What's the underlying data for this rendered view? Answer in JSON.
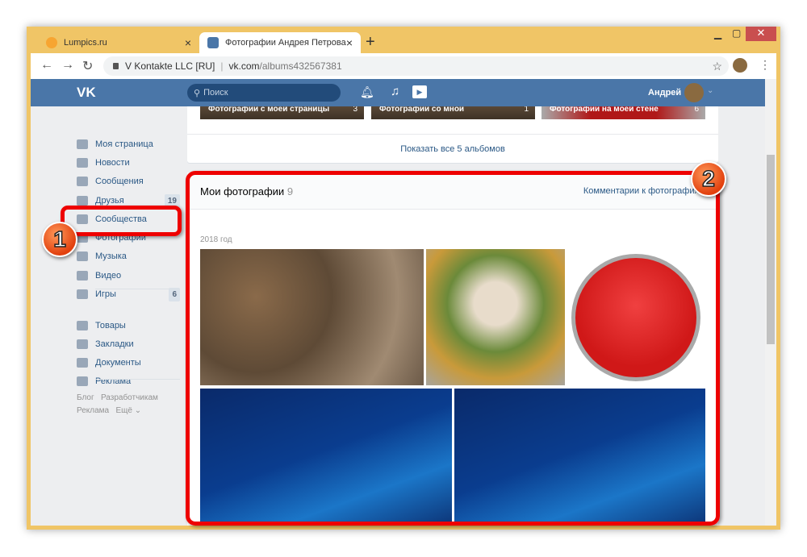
{
  "browser": {
    "tabs": [
      {
        "title": "Lumpics.ru"
      },
      {
        "title": "Фотографии Андрея Петрова –"
      }
    ],
    "site_identity": "V Kontakte LLC [RU]",
    "url_host": "vk.com",
    "url_path": "/albums432567381"
  },
  "vk": {
    "search_placeholder": "Поиск",
    "user_name": "Андрей"
  },
  "sidebar": {
    "items": [
      {
        "label": "Моя страница"
      },
      {
        "label": "Новости"
      },
      {
        "label": "Сообщения"
      },
      {
        "label": "Друзья",
        "badge": "19"
      },
      {
        "label": "Сообщества"
      },
      {
        "label": "Фотографии"
      },
      {
        "label": "Музыка"
      },
      {
        "label": "Видео"
      },
      {
        "label": "Игры",
        "badge": "6"
      },
      {
        "label": "Товары"
      },
      {
        "label": "Закладки"
      },
      {
        "label": "Документы"
      },
      {
        "label": "Реклама"
      }
    ],
    "footer": [
      "Блог",
      "Разработчикам",
      "Реклама",
      "Ещё ⌄"
    ]
  },
  "albums": {
    "items": [
      {
        "title": "Фотографии с моей страницы",
        "count": "3"
      },
      {
        "title": "Фотографии со мной",
        "count": "1"
      },
      {
        "title": "Фотографии на моей стене",
        "count": "6"
      }
    ],
    "show_all": "Показать все 5 альбомов"
  },
  "photos": {
    "title": "Мои фотографии",
    "count": "9",
    "comments_link": "Комментарии к фотографиям",
    "year": "2018 год"
  },
  "annotations": [
    "1",
    "2"
  ]
}
